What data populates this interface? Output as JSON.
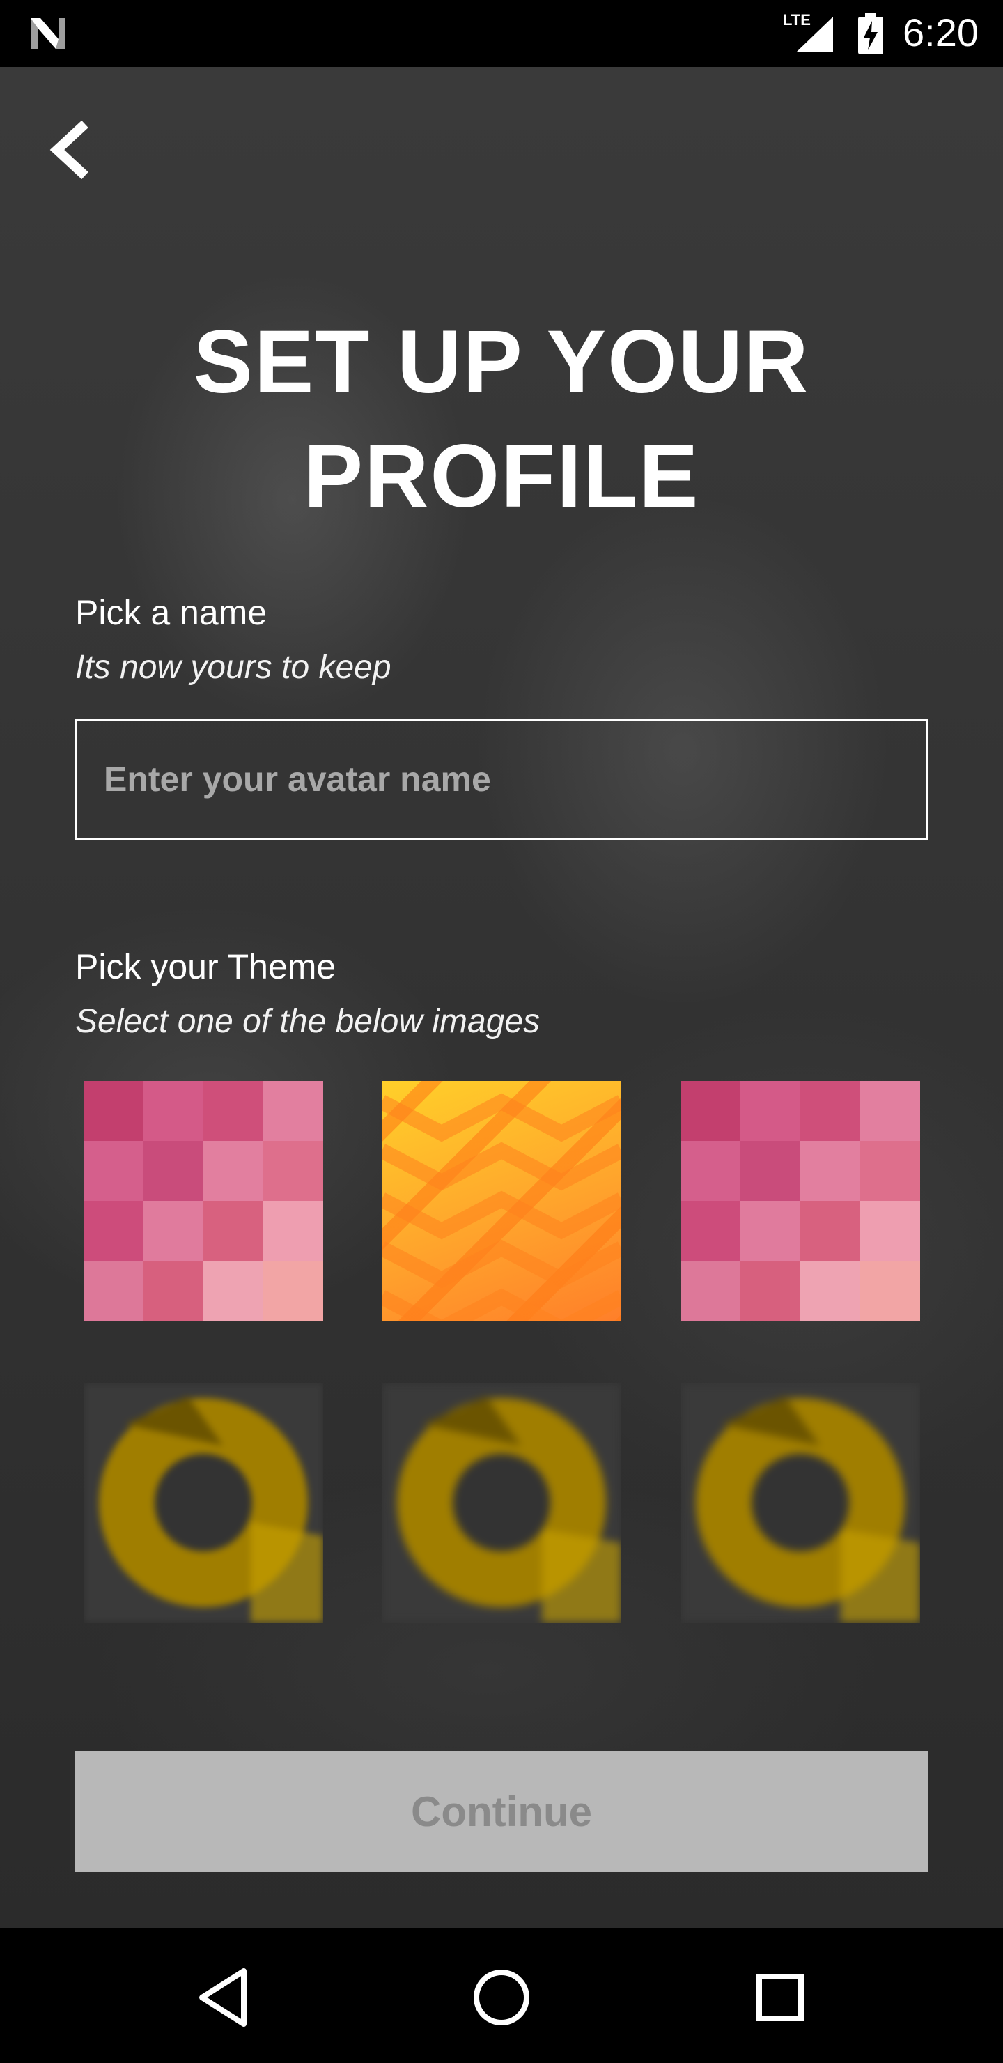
{
  "status_bar": {
    "network": "LTE",
    "time": "6:20",
    "icons": [
      "n-logo-icon",
      "signal-icon",
      "battery-charging-icon"
    ]
  },
  "back_icon": "chevron-left-icon",
  "title": {
    "line1": "SET UP YOUR",
    "line2": "PROFILE"
  },
  "name_section": {
    "label": "Pick a name",
    "subtitle": "Its now yours to keep",
    "input_value": "",
    "input_placeholder": "Enter your avatar name"
  },
  "theme_section": {
    "label": "Pick your Theme",
    "subtitle": "Select one of the below images",
    "tiles": [
      {
        "style": "pink-checker"
      },
      {
        "style": "orange-chevron"
      },
      {
        "style": "pink-checker"
      },
      {
        "style": "blurred-loading"
      },
      {
        "style": "blurred-loading"
      },
      {
        "style": "blurred-loading"
      }
    ]
  },
  "continue_button": {
    "label": "Continue",
    "enabled": false
  },
  "nav_bar": {
    "icons": [
      "back-triangle-icon",
      "home-circle-icon",
      "recents-square-icon"
    ]
  },
  "colors": {
    "status_bar_bg": "#000000",
    "background": "#2f2f2f",
    "button_disabled_bg": "#b8b8b8",
    "button_disabled_text": "#8a8a8a",
    "pink_tile": "#d45a88",
    "orange_tile": "#ffa52c",
    "loading_yellow": "#b58b00"
  }
}
